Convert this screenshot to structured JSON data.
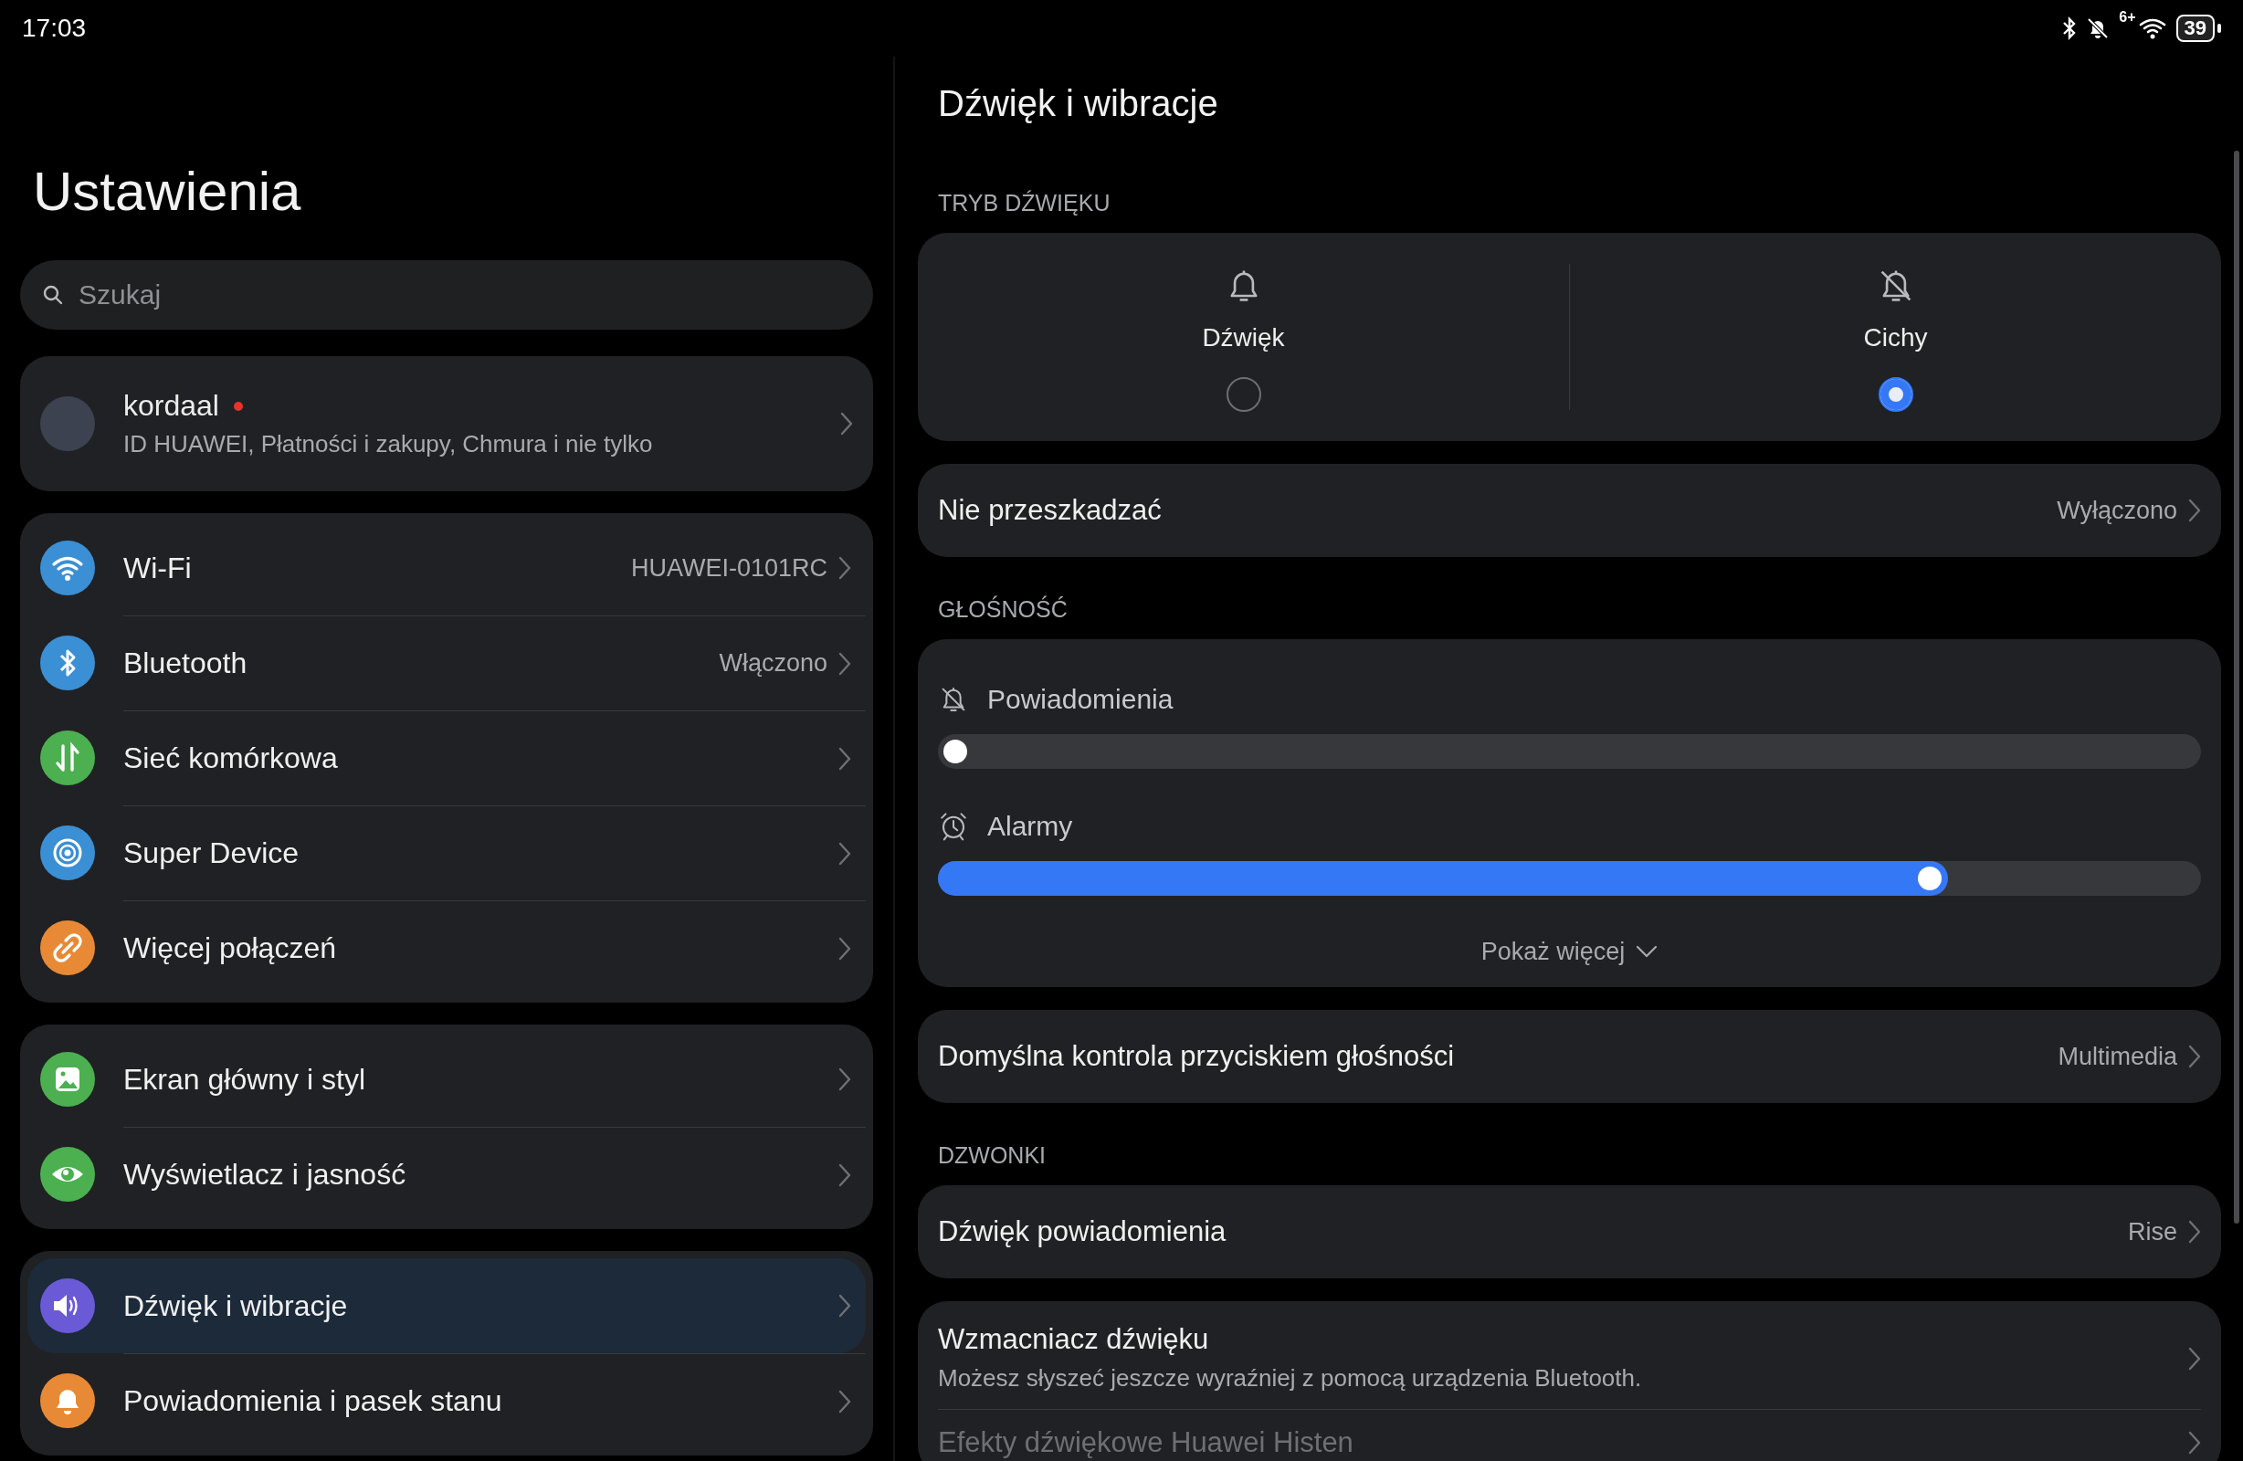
{
  "status_bar": {
    "time": "17:03",
    "network_badge": "6+",
    "battery": "39"
  },
  "sidebar": {
    "title": "Ustawienia",
    "search": {
      "placeholder": "Szukaj"
    },
    "profile": {
      "name": "kordaal",
      "notification_dot": true,
      "subtitle": "ID HUAWEI, Płatności i zakupy, Chmura i nie tylko"
    },
    "groups": [
      {
        "items": [
          {
            "label": "Wi-Fi",
            "value": "HUAWEI-0101RC",
            "color": "#3b8fd4",
            "selected": false
          },
          {
            "label": "Bluetooth",
            "value": "Włączono",
            "color": "#3b8fd4",
            "selected": false
          },
          {
            "label": "Sieć komórkowa",
            "color": "#4caf50",
            "selected": false
          },
          {
            "label": "Super Device",
            "color": "#3b8fd4",
            "selected": false
          },
          {
            "label": "Więcej połączeń",
            "color": "#e88a35",
            "selected": false
          }
        ]
      },
      {
        "items": [
          {
            "label": "Ekran główny i styl",
            "color": "#4caf50",
            "selected": false
          },
          {
            "label": "Wyświetlacz i jasność",
            "color": "#4caf50",
            "selected": false
          }
        ]
      },
      {
        "items": [
          {
            "label": "Dźwięk i wibracje",
            "color": "#6a5ad6",
            "selected": true
          },
          {
            "label": "Powiadomienia i pasek stanu",
            "color": "#e88a35",
            "selected": false
          }
        ]
      }
    ]
  },
  "detail": {
    "title": "Dźwięk i wibracje",
    "blocks": [
      {
        "kind": "header",
        "text": "TRYB DŹWIĘKU"
      },
      {
        "kind": "mode",
        "options": [
          {
            "label": "Dźwięk",
            "selected": false
          },
          {
            "label": "Cichy",
            "selected": true
          }
        ]
      },
      {
        "kind": "row",
        "label": "Nie przeszkadzać",
        "value": "Wyłączono"
      },
      {
        "kind": "header",
        "text": "GŁOŚNOŚĆ"
      },
      {
        "kind": "volume",
        "sliders": [
          {
            "label": "Powiadomienia",
            "level": 0
          },
          {
            "label": "Alarmy",
            "level": 0.8
          }
        ],
        "more": "Pokaż więcej"
      },
      {
        "kind": "row",
        "label": "Domyślna kontrola przyciskiem głośności",
        "value": "Multimedia"
      },
      {
        "kind": "header",
        "text": "DZWONKI"
      },
      {
        "kind": "row",
        "label": "Dźwięk powiadomienia",
        "value": "Rise"
      },
      {
        "kind": "group",
        "rows": [
          {
            "label": "Wzmacniacz dźwięku",
            "description": "Możesz słyszeć jeszcze wyraźniej z pomocą urządzenia Bluetooth.",
            "disabled": false
          },
          {
            "label": "Efekty dźwiękowe Huawei Histen",
            "disabled": true
          }
        ]
      }
    ]
  }
}
